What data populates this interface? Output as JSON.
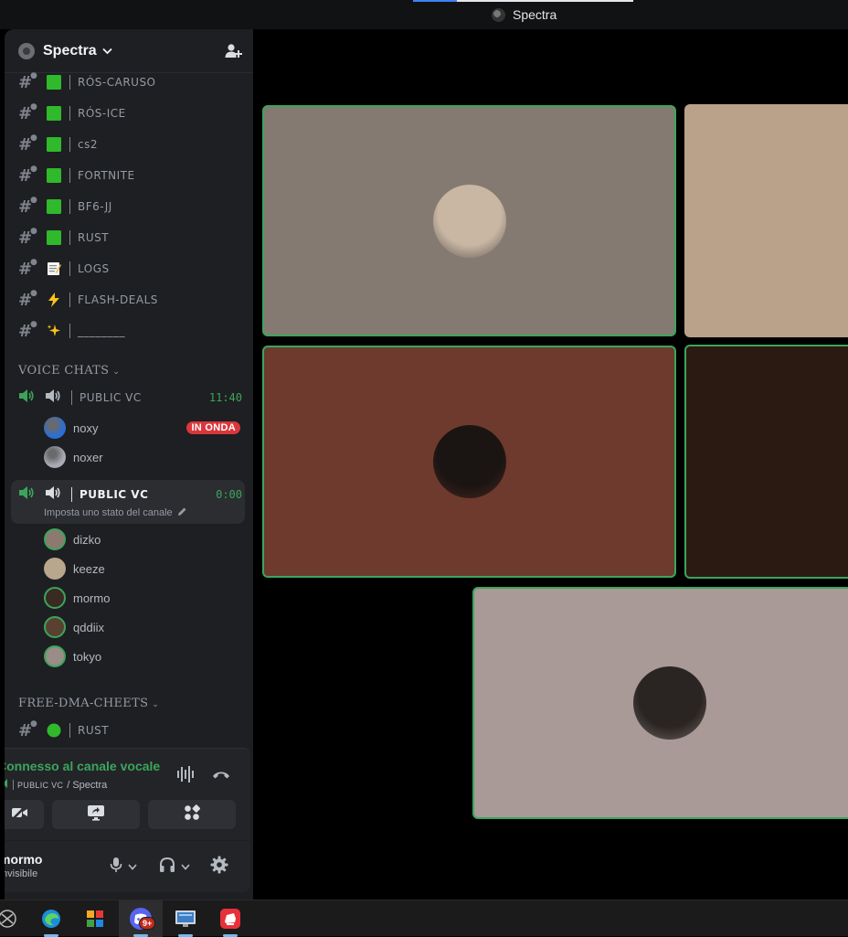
{
  "window": {
    "title": "Spectra"
  },
  "server": {
    "name": "Spectra",
    "icons": {
      "invite": "add-member-icon",
      "chevron": "chevron-down-icon"
    }
  },
  "text_channels": [
    {
      "emoji": "green-square",
      "name": "RÓS-CARUSO"
    },
    {
      "emoji": "green-square",
      "name": "RÓS-ICE"
    },
    {
      "emoji": "green-square",
      "name": "cs2"
    },
    {
      "emoji": "green-square",
      "name": "FORTNITE"
    },
    {
      "emoji": "green-square",
      "name": "BF6-JJ"
    },
    {
      "emoji": "green-square",
      "name": "RUST"
    },
    {
      "emoji": "memo",
      "name": "LOGS"
    },
    {
      "emoji": "lightning",
      "name": "FLASH-DEALS"
    },
    {
      "emoji": "sparkles",
      "name": "________"
    }
  ],
  "voice_category": {
    "label": "VOICE CHATS"
  },
  "voice_channels": [
    {
      "name": "PUBLIC VC",
      "timer": "11:40",
      "users": [
        {
          "name": "noxy",
          "badge": "IN ONDA",
          "avatar_color": "#2a6fd6"
        },
        {
          "name": "noxer",
          "avatar_color": "#a9abb3"
        }
      ]
    },
    {
      "name": "PUBLIC VC",
      "timer": "0:00",
      "status_placeholder": "Imposta uno stato del canale",
      "users": [
        {
          "name": "dizko",
          "avatar_color": "#8c7a70"
        },
        {
          "name": "keeze",
          "avatar_color": "#b8a78d"
        },
        {
          "name": "mormo",
          "avatar_color": "#3a2a22"
        },
        {
          "name": "qddiix",
          "avatar_color": "#5a4030"
        },
        {
          "name": "tokyo",
          "avatar_color": "#9a8c86"
        }
      ]
    }
  ],
  "other_category": {
    "label": "FREE-DMA-CHEETS",
    "first_channel": {
      "emoji": "green-circle",
      "name": "RUST"
    }
  },
  "voice_panel": {
    "status": "Connesso al canale vocale",
    "channel": "PUBLIC VC",
    "server_suffix": "/ Spectra",
    "user": {
      "name": "mormo",
      "status": "Invisibile"
    }
  },
  "stage_tiles": [
    {
      "bg": "#847a71",
      "avatar": "#c9b7a3",
      "speaking": true
    },
    {
      "bg": "#b9a18a",
      "speaking": false
    },
    {
      "bg": "#6e3a2d",
      "avatar": "#1a1412",
      "speaking": true
    },
    {
      "bg": "#2b1a12",
      "speaking": true
    },
    {
      "bg": "#a99a97",
      "avatar": "#2a2522",
      "speaking": true
    }
  ],
  "taskbar": {
    "items": [
      "xbox-icon",
      "edge-icon",
      "store-icon",
      "discord-icon",
      "rdp-icon",
      "riot-icon"
    ],
    "discord_badge": "9+"
  },
  "colors": {
    "accent_green": "#3ba55c",
    "live_red": "#da373c",
    "sidebar_bg": "#1e1f22"
  }
}
